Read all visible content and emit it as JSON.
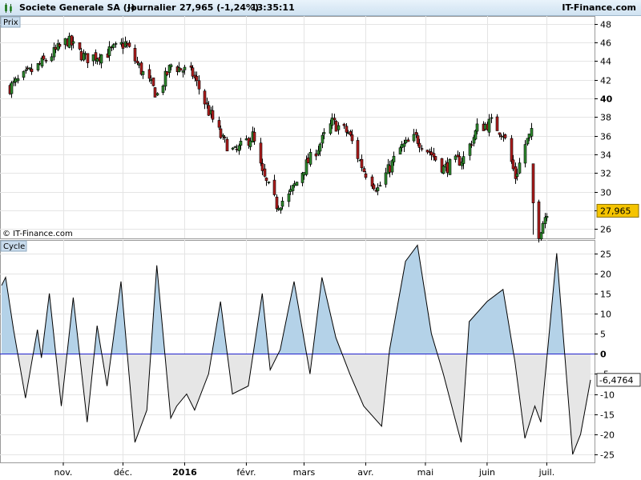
{
  "header": {
    "instrument": "Societe Generale SA (-)",
    "period": "Journalier",
    "quote": "27,965 (-1,24%)",
    "time": "13:35:11",
    "brand": "IT-Finance.com"
  },
  "chart_data": [
    {
      "type": "candlestick",
      "panel_label": "Prix",
      "watermark": "© IT-Finance.com",
      "ylim": [
        25,
        48.5
      ],
      "yticks": [
        26,
        28,
        30,
        32,
        34,
        36,
        38,
        40,
        42,
        44,
        46,
        48
      ],
      "bold_tick": 40,
      "last_value": 27.965,
      "last_value_label": "27,965",
      "colors": {
        "up": "#2e8b2e",
        "down": "#b01c1c",
        "last_badge": "#f5c400"
      },
      "trend": [
        [
          "2015-10-05",
          41.2
        ],
        [
          "2015-10-20",
          43.6
        ],
        [
          "2015-11-03",
          46.2
        ],
        [
          "2015-11-12",
          44.3
        ],
        [
          "2015-11-22",
          44.8
        ],
        [
          "2015-12-02",
          45.9
        ],
        [
          "2015-12-10",
          43.0
        ],
        [
          "2015-12-18",
          40.4
        ],
        [
          "2015-12-25",
          43.6
        ],
        [
          "2016-01-05",
          42.6
        ],
        [
          "2016-01-13",
          38.6
        ],
        [
          "2016-01-20",
          35.5
        ],
        [
          "2016-01-26",
          34.2
        ],
        [
          "2016-02-04",
          36.0
        ],
        [
          "2016-02-09",
          31.8
        ],
        [
          "2016-02-16",
          28.6
        ],
        [
          "2016-02-22",
          29.5
        ],
        [
          "2016-03-01",
          32.6
        ],
        [
          "2016-03-08",
          34.8
        ],
        [
          "2016-03-15",
          37.4
        ],
        [
          "2016-03-23",
          36.3
        ],
        [
          "2016-03-31",
          32.3
        ],
        [
          "2016-04-07",
          30.3
        ],
        [
          "2016-04-18",
          34.6
        ],
        [
          "2016-04-26",
          35.8
        ],
        [
          "2016-05-03",
          34.3
        ],
        [
          "2016-05-10",
          32.5
        ],
        [
          "2016-05-20",
          33.6
        ],
        [
          "2016-05-27",
          36.8
        ],
        [
          "2016-06-03",
          37.4
        ],
        [
          "2016-06-09",
          36.3
        ],
        [
          "2016-06-15",
          31.6
        ],
        [
          "2016-06-20",
          35.1
        ],
        [
          "2016-06-23",
          36.2
        ],
        [
          "2016-06-24",
          28.6
        ],
        [
          "2016-06-27",
          25.6
        ],
        [
          "2016-07-01",
          28.0
        ]
      ]
    },
    {
      "type": "area",
      "panel_label": "Cycle",
      "ylim": [
        -27,
        27.5
      ],
      "yticks": [
        -25,
        -20,
        -15,
        -10,
        -5,
        0,
        5,
        10,
        15,
        20,
        25
      ],
      "last_value": -6.4764,
      "last_value_label": "-6,4764",
      "colors": {
        "positive_fill": "#b4d2e8",
        "negative_fill": "#e6e6e6",
        "zero_line": "#2020cc"
      },
      "series": [
        [
          "2015-10-01",
          17
        ],
        [
          "2015-10-03",
          19
        ],
        [
          "2015-10-07",
          6
        ],
        [
          "2015-10-13",
          -11
        ],
        [
          "2015-10-19",
          6
        ],
        [
          "2015-10-21",
          -1
        ],
        [
          "2015-10-25",
          15
        ],
        [
          "2015-10-31",
          -13
        ],
        [
          "2015-11-06",
          14
        ],
        [
          "2015-11-13",
          -17
        ],
        [
          "2015-11-18",
          7
        ],
        [
          "2015-11-23",
          -8
        ],
        [
          "2015-11-30",
          18
        ],
        [
          "2015-12-07",
          -22
        ],
        [
          "2015-12-13",
          -14
        ],
        [
          "2015-12-18",
          22
        ],
        [
          "2015-12-25",
          -16
        ],
        [
          "2015-12-28",
          -13
        ],
        [
          "2016-01-02",
          -10
        ],
        [
          "2016-01-06",
          -14
        ],
        [
          "2016-01-13",
          -5
        ],
        [
          "2016-01-19",
          13
        ],
        [
          "2016-01-25",
          -10
        ],
        [
          "2016-02-02",
          -8
        ],
        [
          "2016-02-09",
          15
        ],
        [
          "2016-02-13",
          -4
        ],
        [
          "2016-02-18",
          1
        ],
        [
          "2016-02-25",
          18
        ],
        [
          "2016-03-04",
          -5
        ],
        [
          "2016-03-10",
          19
        ],
        [
          "2016-03-17",
          4
        ],
        [
          "2016-03-24",
          -5
        ],
        [
          "2016-03-31",
          -13
        ],
        [
          "2016-04-09",
          -18
        ],
        [
          "2016-04-13",
          1
        ],
        [
          "2016-04-21",
          23
        ],
        [
          "2016-04-27",
          27
        ],
        [
          "2016-05-04",
          5
        ],
        [
          "2016-05-10",
          -5
        ],
        [
          "2016-05-19",
          -22
        ],
        [
          "2016-05-23",
          8
        ],
        [
          "2016-06-01",
          13
        ],
        [
          "2016-06-09",
          16
        ],
        [
          "2016-06-15",
          -2
        ],
        [
          "2016-06-20",
          -21
        ],
        [
          "2016-06-25",
          -13
        ],
        [
          "2016-06-28",
          -17
        ],
        [
          "2016-07-06",
          25
        ],
        [
          "2016-07-14",
          -25
        ],
        [
          "2016-07-18",
          -20
        ],
        [
          "2016-07-23",
          -6.5
        ]
      ]
    }
  ],
  "x_axis": {
    "range": [
      "2015-10-01",
      "2016-07-25"
    ],
    "ticks": [
      {
        "date": "2015-11-01",
        "label": "nov.",
        "bold": false
      },
      {
        "date": "2015-12-01",
        "label": "déc.",
        "bold": false
      },
      {
        "date": "2016-01-01",
        "label": "2016",
        "bold": true
      },
      {
        "date": "2016-02-01",
        "label": "févr.",
        "bold": false
      },
      {
        "date": "2016-03-01",
        "label": "mars",
        "bold": false
      },
      {
        "date": "2016-04-01",
        "label": "avr.",
        "bold": false
      },
      {
        "date": "2016-05-01",
        "label": "mai",
        "bold": false
      },
      {
        "date": "2016-06-01",
        "label": "juin",
        "bold": false
      },
      {
        "date": "2016-07-01",
        "label": "juil.",
        "bold": false
      }
    ]
  }
}
